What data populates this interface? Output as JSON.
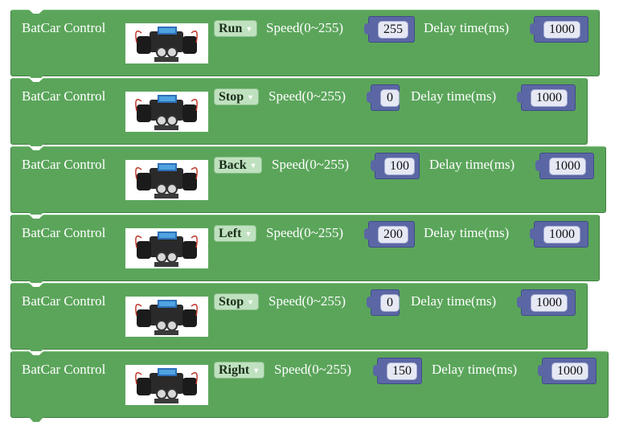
{
  "blocks": [
    {
      "title": "BatCar Control",
      "action": "Run",
      "speed_label": "Speed(0~255)",
      "speed": "255",
      "delay_label": "Delay time(ms)",
      "delay": "1000"
    },
    {
      "title": "BatCar Control",
      "action": "Stop",
      "speed_label": "Speed(0~255)",
      "speed": "0",
      "delay_label": "Delay time(ms)",
      "delay": "1000"
    },
    {
      "title": "BatCar Control",
      "action": "Back",
      "speed_label": "Speed(0~255)",
      "speed": "100",
      "delay_label": "Delay time(ms)",
      "delay": "1000"
    },
    {
      "title": "BatCar Control",
      "action": "Left",
      "speed_label": "Speed(0~255)",
      "speed": "200",
      "delay_label": "Delay time(ms)",
      "delay": "1000"
    },
    {
      "title": "BatCar Control",
      "action": "Stop",
      "speed_label": "Speed(0~255)",
      "speed": "0",
      "delay_label": "Delay time(ms)",
      "delay": "1000"
    },
    {
      "title": "BatCar Control",
      "action": "Right",
      "speed_label": "Speed(0~255)",
      "speed": "150",
      "delay_label": "Delay time(ms)",
      "delay": "1000"
    }
  ],
  "colors": {
    "block_green": "#5ba55b",
    "number_block": "#5b67a5",
    "dropdown_bg": "#bfe1bf"
  },
  "icons": {
    "car": "robot-car-image",
    "dropdown": "triangle-down"
  }
}
